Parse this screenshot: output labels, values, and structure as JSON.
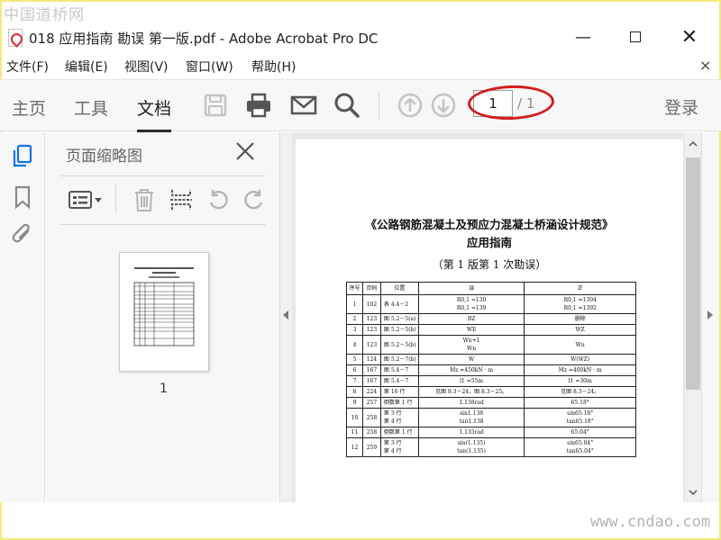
{
  "watermarks": {
    "top": "中国道桥网",
    "bottom": "www.cndao.com"
  },
  "window": {
    "title": "018 应用指南 勘误 第一版.pdf - Adobe Acrobat Pro DC",
    "minimize": "—",
    "close": "✕"
  },
  "menu": {
    "items": [
      "文件(F)",
      "编辑(E)",
      "视图(V)",
      "窗口(W)",
      "帮助(H)"
    ],
    "close": "×"
  },
  "toolbar": {
    "tabs": [
      "主页",
      "工具",
      "文档"
    ],
    "active_tab": "文档",
    "page_current": "1",
    "page_total": "/ 1",
    "login": "登录",
    "icons": [
      "save-icon",
      "print-icon",
      "mail-icon",
      "search-icon",
      "page-up-icon",
      "page-down-icon"
    ]
  },
  "sidebar": {
    "icons": [
      "pages-icon",
      "bookmark-icon",
      "attachment-icon"
    ],
    "accent": "#1473e6"
  },
  "thumbnails_panel": {
    "title": "页面缩略图",
    "tool_icons": [
      "options-icon",
      "delete-icon",
      "insert-icon",
      "undo-icon",
      "redo-icon"
    ],
    "page_label": "1"
  },
  "document": {
    "title_line1": "《公路钢筋混凝土及预应力混凝土桥涵设计规范》",
    "title_line2": "应用指南",
    "title_line3": "（第 1 版第 1 次勘误）",
    "table_headers": [
      "序号",
      "页码",
      "位置",
      "误",
      "正"
    ],
    "rows": [
      {
        "no": "1",
        "page": "102",
        "pos": "表 4.4－2",
        "wrong": "R0,1 =130 / R0,1 =139",
        "right": "R0,1 =1304 / R0,1 =1392"
      },
      {
        "no": "2",
        "page": "123",
        "pos": "图 5.2－5(a)",
        "wrong": "BZ",
        "right": "删除"
      },
      {
        "no": "3",
        "page": "123",
        "pos": "图 5.2－5(b)",
        "wrong": "WE",
        "right": "WZ"
      },
      {
        "no": "4",
        "page": "123",
        "pos": "图 5.2－5(b)",
        "wrong": "Wn+1 / Wn",
        "right": "Wn"
      },
      {
        "no": "5",
        "page": "124",
        "pos": "图 5.2－7(b)",
        "wrong": "W",
        "right": "W(WZ)"
      },
      {
        "no": "6",
        "page": "167",
        "pos": "图 5.4－7",
        "wrong": "Mz =450kN · m",
        "right": "Mz =400kN · m"
      },
      {
        "no": "7",
        "page": "167",
        "pos": "图 5.4－7",
        "wrong": "l1 =55m",
        "right": "l1 =30m"
      },
      {
        "no": "8",
        "page": "224",
        "pos": "第 16 行",
        "wrong": "见图 8.3－24，图 8.3－25。",
        "right": "见图 8.3－24。"
      },
      {
        "no": "9",
        "page": "257",
        "pos": "倒数第 1 行",
        "wrong": "1.138rad",
        "right": "65.18°"
      },
      {
        "no": "10",
        "page": "258",
        "pos": "第 3 行 / 第 4 行",
        "wrong": "sin1.138 / tan1.138",
        "right": "sin65.18° / tan65.18°"
      },
      {
        "no": "11",
        "page": "258",
        "pos": "倒数第 1 行",
        "wrong": "1.135rad",
        "right": "65.04°"
      },
      {
        "no": "12",
        "page": "259",
        "pos": "第 3 行 / 第 4 行",
        "wrong": "sin(1.135) / tan(1.135)",
        "right": "sin65.04° / tan65.04°"
      }
    ]
  },
  "colors": {
    "annotation_red": "#d11e1e",
    "frame_yellow": "#f5e97a"
  }
}
